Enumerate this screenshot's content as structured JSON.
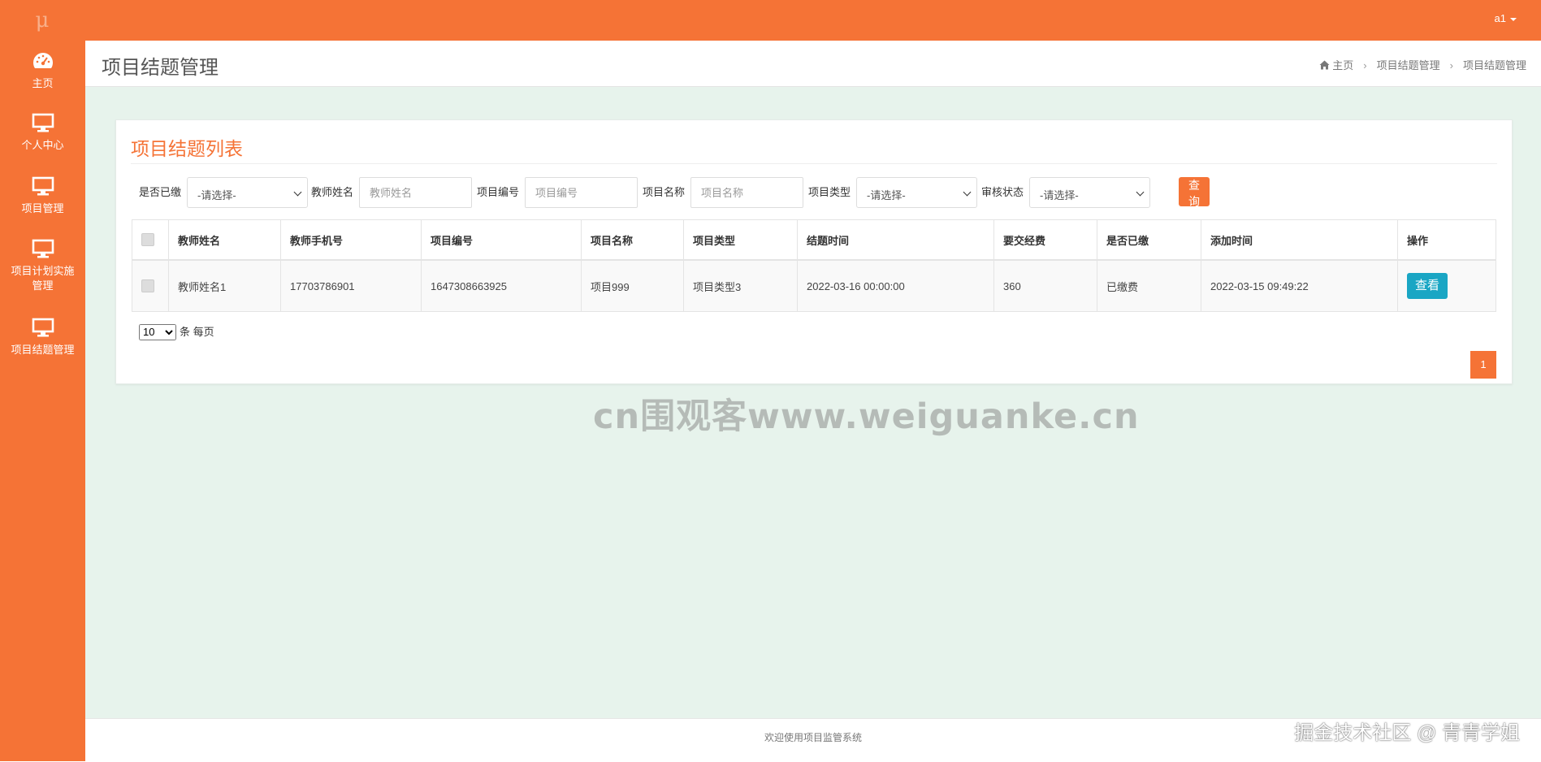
{
  "topbar": {
    "logo": "μ",
    "user": "a1"
  },
  "sidebar": {
    "items": [
      {
        "label": "主页",
        "icon": "dashboard-icon"
      },
      {
        "label": "个人中心",
        "icon": "monitor-icon"
      },
      {
        "label": "项目管理",
        "icon": "monitor-icon"
      },
      {
        "label": "项目计划实施管理",
        "icon": "monitor-icon"
      },
      {
        "label": "项目结题管理",
        "icon": "monitor-icon"
      }
    ]
  },
  "page": {
    "title": "项目结题管理",
    "breadcrumb": [
      "主页",
      "项目结题管理",
      "项目结题管理"
    ]
  },
  "panel": {
    "title": "项目结题列表"
  },
  "filters": {
    "paid_label": "是否已缴",
    "paid_value": "-请选择-",
    "teacher_label": "教师姓名",
    "teacher_placeholder": "教师姓名",
    "code_label": "项目编号",
    "code_placeholder": "项目编号",
    "name_label": "项目名称",
    "name_placeholder": "项目名称",
    "type_label": "项目类型",
    "type_value": "-请选择-",
    "audit_label": "审核状态",
    "audit_value": "-请选择-",
    "query_button": "查询"
  },
  "table": {
    "headers": [
      "教师姓名",
      "教师手机号",
      "项目编号",
      "项目名称",
      "项目类型",
      "结题时间",
      "要交经费",
      "是否已缴",
      "添加时间",
      "操作"
    ],
    "rows": [
      {
        "teacher": "教师姓名1",
        "phone": "17703786901",
        "code": "1647308663925",
        "name": "项目999",
        "type": "项目类型3",
        "end_time": "2022-03-16 00:00:00",
        "fee": "360",
        "paid": "已缴费",
        "added": "2022-03-15 09:49:22",
        "action": "查看"
      }
    ]
  },
  "pagination": {
    "page_size": "10",
    "page_size_suffix": "条 每页",
    "current_page": "1"
  },
  "watermark": "cn围观客www.weiguanke.cn",
  "footer": {
    "text": "欢迎使用项目监管系统",
    "credit": "掘金技术社区 @ 青青学姐"
  },
  "colors": {
    "brand": "#f57336",
    "view_button": "#1aa6c4",
    "content_bg": "#e7f3ec"
  }
}
